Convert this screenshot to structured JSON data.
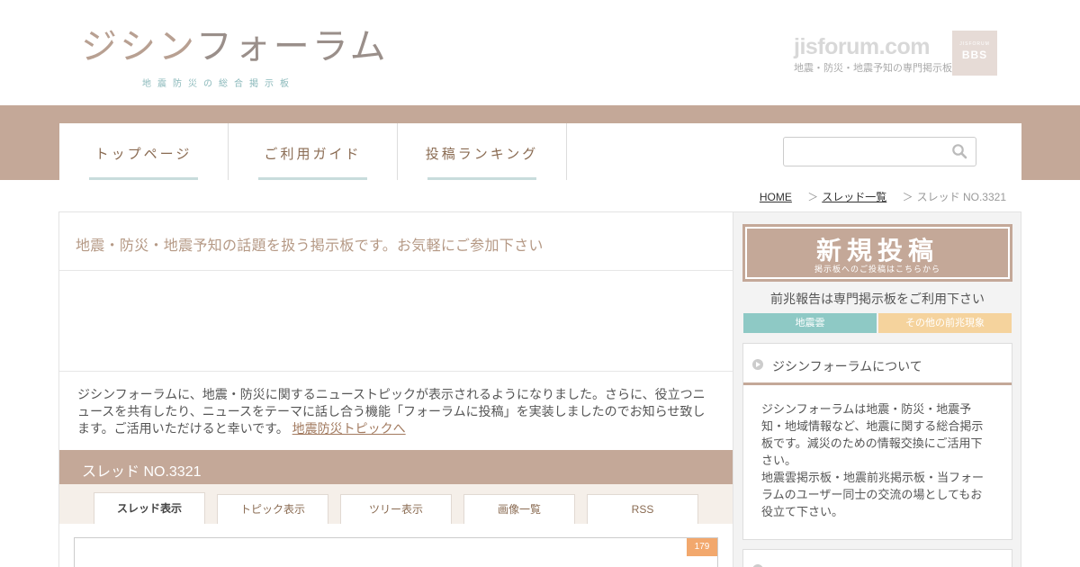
{
  "header": {
    "logo_part1": "ジシン",
    "logo_part2": "フォーラム",
    "logo_subtitle": "地震防災の総合掲示板",
    "site_domain": "jisforum.com",
    "site_tagline": "地震・防災・地震予知の専門掲示板",
    "bbs_small": "JISFORUM",
    "bbs_label": "BBS"
  },
  "nav": {
    "items": [
      {
        "label": "トップページ"
      },
      {
        "label": "ご利用ガイド"
      },
      {
        "label": "投稿ランキング"
      }
    ],
    "search_value": ""
  },
  "breadcrumb": {
    "home": "HOME",
    "list": "スレッド一覧",
    "current": "スレッド NO.3321",
    "sep": "＞"
  },
  "main": {
    "intro": "地震・防災・地震予知の話題を扱う掲示板です。お気軽にご参加下さい",
    "notice_text": "ジシンフォーラムに、地震・防災に関するニューストピックが表示されるようになりました。さらに、役立つニュースを共有したり、ニュースをテーマに話し合う機能「フォーラムに投稿」を実装しましたのでお知らせ致します。ご活用いただけると幸いです。",
    "notice_link": "地震防災トピックへ",
    "thread_title": "スレッド NO.3321",
    "tabs": [
      {
        "label": "スレッド表示"
      },
      {
        "label": "トピック表示"
      },
      {
        "label": "ツリー表示"
      },
      {
        "label": "画像一覧"
      },
      {
        "label": "RSS"
      }
    ],
    "post_count": "179"
  },
  "sidebar": {
    "new_post": "新規投稿",
    "new_post_sub": "掲示板へのご投稿はこちらから",
    "note": "前兆報告は専門掲示板をご利用下さい",
    "btn_quake_cloud": "地震雲",
    "btn_other": "その他の前兆現象",
    "about_title": "ジシンフォーラムについて",
    "about_body_1": "ジシンフォーラムは地震・防災・地震予知・地域情報など、地震に関する総合掲示板です。減災のための情報交換にご活用下さい。",
    "about_body_2": "地震雲掲示板・地震前兆掲示板・当フォーラムのユーザー同士の交流の場としてもお役立て下さい。",
    "colors": {
      "accent": "#c4a898",
      "teal": "#8ec9c5",
      "peach": "#f5d39d",
      "badge": "#f2a86d"
    }
  }
}
